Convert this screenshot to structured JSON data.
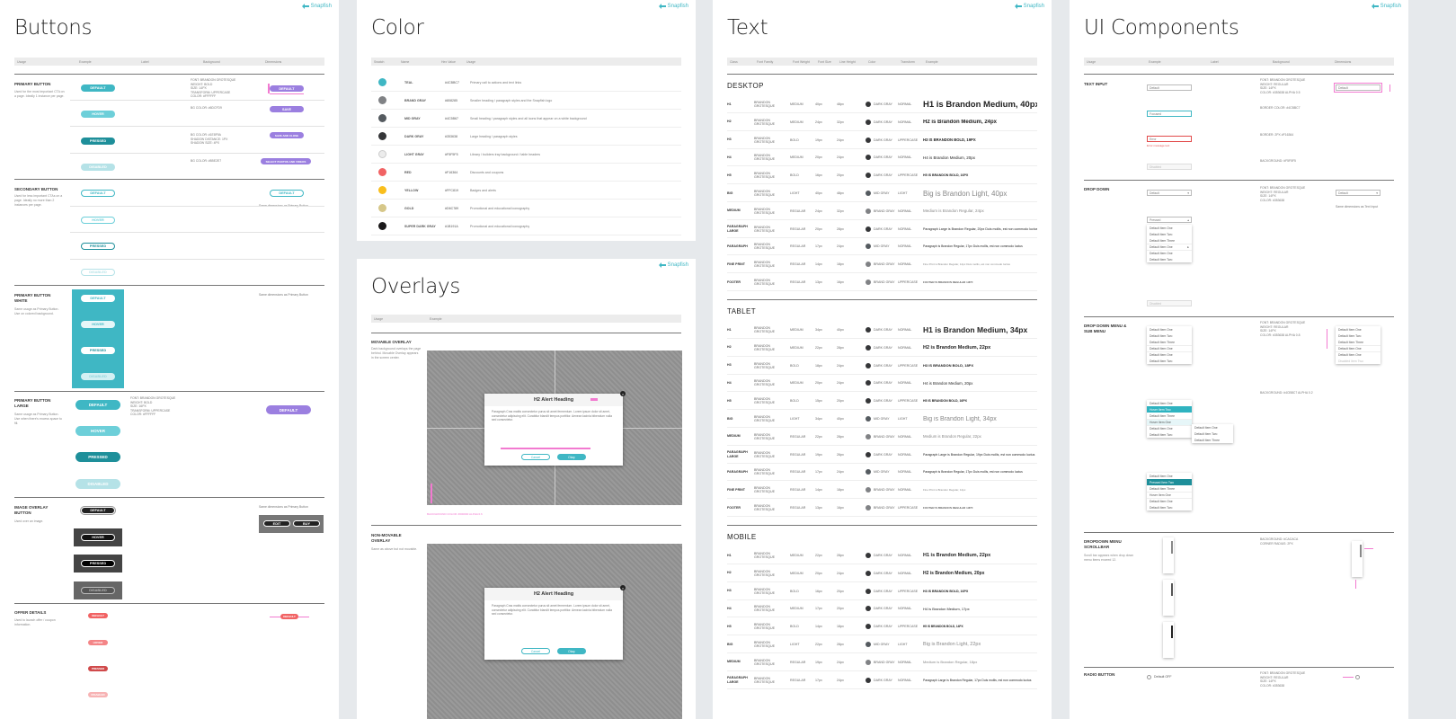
{
  "brand": "Snapfish",
  "colors": {
    "teal": "#3fb7c4",
    "teal_hover": "#6dcfd9",
    "teal_pressed": "#1e8f9a",
    "teal_disabled": "#b5e2e7",
    "pink": "#f27ad0",
    "dark": "#333333",
    "gray": "#8a8a8a"
  },
  "buttons": {
    "title": "Buttons",
    "columns": [
      "Usage",
      "Example",
      "Label",
      "Background",
      "Dimensions"
    ],
    "primary": {
      "label": "Primary Button",
      "desc": "Used for the most important CTA on a page. Ideally 1 instance per page."
    },
    "secondary": {
      "label": "Secondary Button",
      "desc": "Used for less important CTAs on a page. Ideally no more than 2 instances per page."
    },
    "white": {
      "label": "Primary Button White",
      "desc": "Same usage as Primary Button. Use on colored background."
    },
    "large": {
      "label": "Primary Button Large",
      "desc": "Same usage as Primary Button. Use when there's excess space to fill."
    },
    "image": {
      "label": "Image Overlay Button",
      "desc": "Used over an image."
    },
    "offer": {
      "label": "Offer Details",
      "desc": "Used to launch offer / coupon information."
    },
    "states": [
      "Default",
      "Hover",
      "Pressed",
      "Disabled"
    ],
    "same_dims": "Same dimensions as Primary Button",
    "edit": "Edit",
    "buy": "Buy",
    "save_close": "Save and close",
    "select_photos": "Select photos and videos",
    "save": "Save"
  },
  "color": {
    "title": "Color",
    "columns": [
      "Swatch",
      "Name",
      "Hex Value",
      "Usage"
    ],
    "rows": [
      {
        "name": "Teal",
        "hex": "#4CBBC7",
        "color": "#3fb7c4",
        "usage": "Primary call to actions and text links"
      },
      {
        "name": "Brand Gray",
        "hex": "#808285",
        "color": "#808285",
        "usage": "Smaller heading / paragraph styles and the Snapfish logo"
      },
      {
        "name": "Mid Gray",
        "hex": "#4C5B67",
        "color": "#555b60",
        "usage": "Small heading / paragraph styles and all icons that appear on a white background"
      },
      {
        "name": "Dark Gray",
        "hex": "#353638",
        "color": "#353638",
        "usage": "Large heading / paragraph styles"
      },
      {
        "name": "Light Gray",
        "hex": "#F5F5F5",
        "color": "#ececec",
        "usage": "Library / builders tray background / table headers"
      },
      {
        "name": "Red",
        "hex": "#F16364",
        "color": "#f16364",
        "usage": "Discounts and coupons"
      },
      {
        "name": "Yellow",
        "hex": "#FFC819",
        "color": "#f9be1c",
        "usage": "Badges and alerts"
      },
      {
        "name": "Gold",
        "hex": "#D6C789",
        "color": "#d6c789",
        "usage": "Promotional and educational iconography"
      },
      {
        "name": "Super Dark Gray",
        "hex": "#1B191A",
        "color": "#1b191a",
        "usage": "Promotional and educational iconography"
      }
    ]
  },
  "overlays": {
    "title": "Overlays",
    "columns": [
      "Usage",
      "Example"
    ],
    "movable": {
      "label": "Movable Overlay",
      "desc": "Dark background overlays the page behind. Movable Overlay appears in the screen center."
    },
    "nonmovable": {
      "label": "Non-Movable Overlay",
      "desc": "Same as above but not movable."
    },
    "alert_title": "H2 Alert Heading",
    "alert_body": "Paragraph Cras mattis consectetur purus sit amet fermentum. Lorem ipsum dolor sit amet, consectetur adipiscing elit. Curabitur blandit tempus porttitor. Aenean lacinia bibendum nulla sed consectetur.",
    "cancel": "Cancel",
    "okay": "Okay",
    "bg_note": "Background color: #000000 alpha 0.6"
  },
  "text": {
    "title": "Text",
    "columns": [
      "Class",
      "Font Family",
      "Font Weight",
      "Font Size",
      "Line Height",
      "Color",
      "Transform",
      "Example"
    ],
    "groups": [
      {
        "name": "Desktop",
        "rows": [
          {
            "c": "H1",
            "f": "Brandon Grotesque",
            "w": "Medium",
            "s": "40px",
            "lh": "48px",
            "col": "Dark Gray",
            "dot": "#353638",
            "t": "Normal",
            "ex": "H1 is Brandon Medium, 40px",
            "size": 9.5,
            "bold": true
          },
          {
            "c": "H2",
            "f": "Brandon Grotesque",
            "w": "Medium",
            "s": "24px",
            "lh": "32px",
            "col": "Dark Gray",
            "dot": "#353638",
            "t": "Normal",
            "ex": "H2 is Brandon Medium, 24px",
            "size": 6,
            "bold": true
          },
          {
            "c": "H3",
            "f": "Brandon Grotesque",
            "w": "Bold",
            "s": "19px",
            "lh": "24px",
            "col": "Dark Gray",
            "dot": "#353638",
            "t": "Uppercase",
            "ex": "H3 IS BRANDON BOLD, 19PX",
            "size": 4.2,
            "bold": true
          },
          {
            "c": "H4",
            "f": "Brandon Grotesque",
            "w": "Medium",
            "s": "20px",
            "lh": "24px",
            "col": "Dark Gray",
            "dot": "#353638",
            "t": "Normal",
            "ex": "H4 is Brandon Medium, 20px",
            "size": 4.5,
            "bold": false
          },
          {
            "c": "H5",
            "f": "Brandon Grotesque",
            "w": "Bold",
            "s": "16px",
            "lh": "20px",
            "col": "Dark Gray",
            "dot": "#353638",
            "t": "Uppercase",
            "ex": "H5 IS BRANDON BOLD, 16PX",
            "size": 3.6,
            "bold": true
          },
          {
            "c": "Big",
            "f": "Brandon Grotesque",
            "w": "Light",
            "s": "40px",
            "lh": "48px",
            "col": "Mid Gray",
            "dot": "#555b60",
            "t": "Light",
            "ex": "Big is Brandon Light, 40px",
            "size": 8,
            "bold": false,
            "light": true
          },
          {
            "c": "Medium",
            "f": "Brandon Grotesque",
            "w": "Regular",
            "s": "24px",
            "lh": "32px",
            "col": "Brand Gray",
            "dot": "#808285",
            "t": "Normal",
            "ex": "Medium is Brandon Regular, 24px",
            "size": 4.5,
            "bold": false,
            "light": true
          },
          {
            "c": "Paragraph Large",
            "f": "Brandon Grotesque",
            "w": "Regular",
            "s": "20px",
            "lh": "28px",
            "col": "Dark Gray",
            "dot": "#353638",
            "t": "Normal",
            "ex": "Paragraph Large is Brandon Regular, 20px Duis mollis, est non commodo luctus",
            "size": 3.6,
            "bold": false
          },
          {
            "c": "Paragraph",
            "f": "Brandon Grotesque",
            "w": "Regular",
            "s": "17px",
            "lh": "24px",
            "col": "Mid Gray",
            "dot": "#555b60",
            "t": "Normal",
            "ex": "Paragraph is Brandon Regular, 17px Duis mollis, est non commodo luctus",
            "size": 3.4,
            "bold": false
          },
          {
            "c": "Fine Print",
            "f": "Brandon Grotesque",
            "w": "Regular",
            "s": "14px",
            "lh": "18px",
            "col": "Brand Gray",
            "dot": "#808285",
            "t": "Normal",
            "ex": "Fine Print is Brandon Regular, 14px Duis mollis, est non commodo luctus",
            "size": 3,
            "bold": false,
            "light": true
          },
          {
            "c": "Footer",
            "f": "Brandon Grotesque",
            "w": "Regular",
            "s": "13px",
            "lh": "16px",
            "col": "Brand Gray",
            "dot": "#808285",
            "t": "Uppercase",
            "ex": "FOOTER IS BRANDON REGULAR 13PX",
            "size": 3,
            "bold": false
          }
        ]
      },
      {
        "name": "Tablet",
        "rows": [
          {
            "c": "H1",
            "f": "Brandon Grotesque",
            "w": "Medium",
            "s": "34px",
            "lh": "40px",
            "col": "Dark Gray",
            "dot": "#353638",
            "t": "Normal",
            "ex": "H1 is Brandon Medium, 34px",
            "size": 8.5,
            "bold": true
          },
          {
            "c": "H2",
            "f": "Brandon Grotesque",
            "w": "Medium",
            "s": "22px",
            "lh": "28px",
            "col": "Dark Gray",
            "dot": "#353638",
            "t": "Normal",
            "ex": "H2 is Brandon Medium, 22px",
            "size": 5.5,
            "bold": true
          },
          {
            "c": "H3",
            "f": "Brandon Grotesque",
            "w": "Bold",
            "s": "18px",
            "lh": "24px",
            "col": "Dark Gray",
            "dot": "#353638",
            "t": "Uppercase",
            "ex": "H3 IS BRANDON BOLD, 18PX",
            "size": 4,
            "bold": true
          },
          {
            "c": "H4",
            "f": "Brandon Grotesque",
            "w": "Medium",
            "s": "20px",
            "lh": "24px",
            "col": "Dark Gray",
            "dot": "#353638",
            "t": "Normal",
            "ex": "H4 is Brandon Medium, 20px",
            "size": 4.3,
            "bold": false
          },
          {
            "c": "H5",
            "f": "Brandon Grotesque",
            "w": "Bold",
            "s": "15px",
            "lh": "20px",
            "col": "Dark Gray",
            "dot": "#353638",
            "t": "Uppercase",
            "ex": "H5 IS BRANDON BOLD, 16PX",
            "size": 3.5,
            "bold": true
          },
          {
            "c": "Big",
            "f": "Brandon Grotesque",
            "w": "Light",
            "s": "34px",
            "lh": "40px",
            "col": "Mid Gray",
            "dot": "#555b60",
            "t": "Light",
            "ex": "Big is Brandon Light, 34px",
            "size": 7,
            "bold": false,
            "light": true
          },
          {
            "c": "Medium",
            "f": "Brandon Grotesque",
            "w": "Regular",
            "s": "22px",
            "lh": "28px",
            "col": "Brand Gray",
            "dot": "#808285",
            "t": "Normal",
            "ex": "Medium is Brandon Regular, 22px",
            "size": 4.3,
            "bold": false,
            "light": true
          },
          {
            "c": "Paragraph Large",
            "f": "Brandon Grotesque",
            "w": "Regular",
            "s": "19px",
            "lh": "26px",
            "col": "Dark Gray",
            "dot": "#353638",
            "t": "Normal",
            "ex": "Paragraph Large is Brandon Regular, 19px Duis mollis, est non commodo luctus",
            "size": 3.5,
            "bold": false
          },
          {
            "c": "Paragraph",
            "f": "Brandon Grotesque",
            "w": "Regular",
            "s": "17px",
            "lh": "24px",
            "col": "Mid Gray",
            "dot": "#555b60",
            "t": "Normal",
            "ex": "Paragraph is Brandon Regular, 17px Duis mollis, est non commodo luctus",
            "size": 3.4,
            "bold": false
          },
          {
            "c": "Fine Print",
            "f": "Brandon Grotesque",
            "w": "Regular",
            "s": "14px",
            "lh": "18px",
            "col": "Brand Gray",
            "dot": "#808285",
            "t": "Normal",
            "ex": "Fine Print is Brandon Regular, 14px",
            "size": 3,
            "bold": false,
            "light": true
          },
          {
            "c": "Footer",
            "f": "Brandon Grotesque",
            "w": "Regular",
            "s": "13px",
            "lh": "16px",
            "col": "Brand Gray",
            "dot": "#808285",
            "t": "Uppercase",
            "ex": "FOOTER IS BRANDON REGULAR 13PX",
            "size": 3,
            "bold": false
          }
        ]
      },
      {
        "name": "Mobile",
        "rows": [
          {
            "c": "H1",
            "f": "Brandon Grotesque",
            "w": "Medium",
            "s": "22px",
            "lh": "28px",
            "col": "Dark Gray",
            "dot": "#353638",
            "t": "Normal",
            "ex": "H1 is Brandon Medium, 22px",
            "size": 5.5,
            "bold": true
          },
          {
            "c": "H2",
            "f": "Brandon Grotesque",
            "w": "Medium",
            "s": "20px",
            "lh": "24px",
            "col": "Dark Gray",
            "dot": "#353638",
            "t": "Normal",
            "ex": "H2 is Brandon Medium, 20px",
            "size": 5,
            "bold": true
          },
          {
            "c": "H3",
            "f": "Brandon Grotesque",
            "w": "Bold",
            "s": "16px",
            "lh": "20px",
            "col": "Dark Gray",
            "dot": "#353638",
            "t": "Uppercase",
            "ex": "H3 IS BRANDON BOLD, 16PX",
            "size": 3.6,
            "bold": true
          },
          {
            "c": "H4",
            "f": "Brandon Grotesque",
            "w": "Medium",
            "s": "17px",
            "lh": "20px",
            "col": "Dark Gray",
            "dot": "#353638",
            "t": "Normal",
            "ex": "H4 is Brandon Medium, 17px",
            "size": 4,
            "bold": false
          },
          {
            "c": "H5",
            "f": "Brandon Grotesque",
            "w": "Bold",
            "s": "14px",
            "lh": "18px",
            "col": "Dark Gray",
            "dot": "#353638",
            "t": "Uppercase",
            "ex": "H5 IS BRANDON BOLD, 14PX",
            "size": 3.2,
            "bold": true
          },
          {
            "c": "Big",
            "f": "Brandon Grotesque",
            "w": "Light",
            "s": "22px",
            "lh": "28px",
            "col": "Mid Gray",
            "dot": "#555b60",
            "t": "Light",
            "ex": "Big is Brandon Light, 22px",
            "size": 5.5,
            "bold": false,
            "light": true
          },
          {
            "c": "Medium",
            "f": "Brandon Grotesque",
            "w": "Regular",
            "s": "19px",
            "lh": "24px",
            "col": "Brand Gray",
            "dot": "#808285",
            "t": "Normal",
            "ex": "Medium is Brandon Regular, 18px",
            "size": 4,
            "bold": false,
            "light": true
          },
          {
            "c": "Paragraph Large",
            "f": "Brandon Grotesque",
            "w": "Regular",
            "s": "17px",
            "lh": "24px",
            "col": "Dark Gray",
            "dot": "#353638",
            "t": "Normal",
            "ex": "Paragraph Large is Brandon Regular, 17px Duis mollis, est non commodo luctus",
            "size": 3.4,
            "bold": false
          }
        ]
      }
    ]
  },
  "ui": {
    "title": "UI Components",
    "columns": [
      "Usage",
      "Example",
      "Label",
      "Background",
      "Dimensions"
    ],
    "text_input": "Text Input",
    "drop_down": "Drop Down",
    "drop_down_menu": "Drop Down Menu & Sub Menu",
    "scrollbar": {
      "label": "Dropdown Menu Scrollbar",
      "desc": "Scroll bar appears when drop down menu items exceed 12."
    },
    "radio": "Radio Button",
    "radio_default": "Default OFF",
    "inputs": [
      "Default",
      "Focused",
      "Error",
      "Disabled"
    ],
    "error_msg": "Error message text",
    "dd_default": "Default",
    "dd_pressed": "Pressed",
    "same_text_input": "Same dimensions as Text Input",
    "items": [
      "Default Item One",
      "Default Item Two",
      "Default Item Three"
    ],
    "hover_one": "Hover Item One",
    "hover_two": "Hover Item Two",
    "pressed_two": "Pressed Item Two",
    "disabled_item": "Disabled Item Two"
  }
}
